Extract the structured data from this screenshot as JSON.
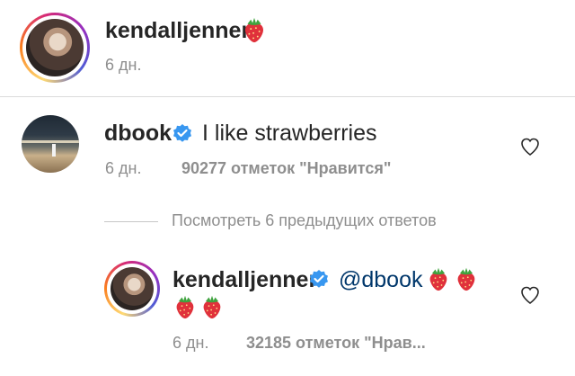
{
  "post": {
    "username": "kendalljenner",
    "time": "6 дн.",
    "avatar_icon": "profile-photo"
  },
  "comment": {
    "username": "dbook",
    "verified_icon": "verified-badge",
    "text": "I like strawberries",
    "time": "6 дн.",
    "likes": "90277 отметок \"Нравится\"",
    "like_icon": "heart-outline"
  },
  "replies": {
    "view_label": "Посмотреть 6 предыдущих ответов"
  },
  "reply": {
    "username": "kendalljenner",
    "verified_icon": "verified-badge",
    "mention": "@dbook",
    "time": "6 дн.",
    "likes": "32185 отметок \"Нрав...",
    "like_icon": "heart-outline"
  },
  "colors": {
    "verified": "#3897f0",
    "strawberry": "#e0313b",
    "leaf": "#3fa33f",
    "muted": "#8e8e8e"
  }
}
